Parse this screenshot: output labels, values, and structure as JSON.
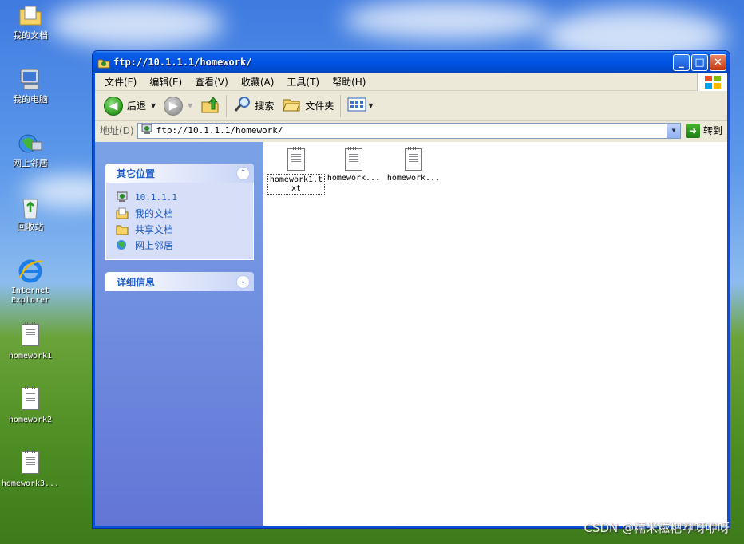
{
  "desktop": {
    "icons": [
      {
        "label": "我的文档"
      },
      {
        "label": "我的电脑"
      },
      {
        "label": "网上邻居"
      },
      {
        "label": "回收站"
      },
      {
        "label": "Internet Explorer"
      },
      {
        "label": "homework1"
      },
      {
        "label": "homework2"
      },
      {
        "label": "homework3..."
      }
    ],
    "watermark": "CSDN @糯米糍粑咿呀咿呀"
  },
  "window": {
    "title": "ftp://10.1.1.1/homework/",
    "controls": {
      "minimize": "_",
      "maximize": "□",
      "close": "✕"
    }
  },
  "menubar": {
    "items": [
      {
        "label": "文件(F)"
      },
      {
        "label": "编辑(E)"
      },
      {
        "label": "查看(V)"
      },
      {
        "label": "收藏(A)"
      },
      {
        "label": "工具(T)"
      },
      {
        "label": "帮助(H)"
      }
    ]
  },
  "toolbar": {
    "back_label": "后退",
    "search_label": "搜索",
    "folders_label": "文件夹"
  },
  "address": {
    "label": "地址(D)",
    "value": "ftp://10.1.1.1/homework/",
    "go_label": "转到"
  },
  "taskpane": {
    "other_places": {
      "title": "其它位置",
      "items": [
        {
          "label": "10.1.1.1",
          "icon": "ftp-icon"
        },
        {
          "label": "我的文档",
          "icon": "documents-icon"
        },
        {
          "label": "共享文档",
          "icon": "folder-icon"
        },
        {
          "label": "网上邻居",
          "icon": "network-icon"
        }
      ]
    },
    "details": {
      "title": "详细信息"
    }
  },
  "files": [
    {
      "label": "homework1.txt",
      "selected": true
    },
    {
      "label": "homework..."
    },
    {
      "label": "homework..."
    }
  ],
  "colors": {
    "title_blue": "#0054e3",
    "taskpane_link": "#215dc6",
    "close_red": "#c2360c"
  }
}
